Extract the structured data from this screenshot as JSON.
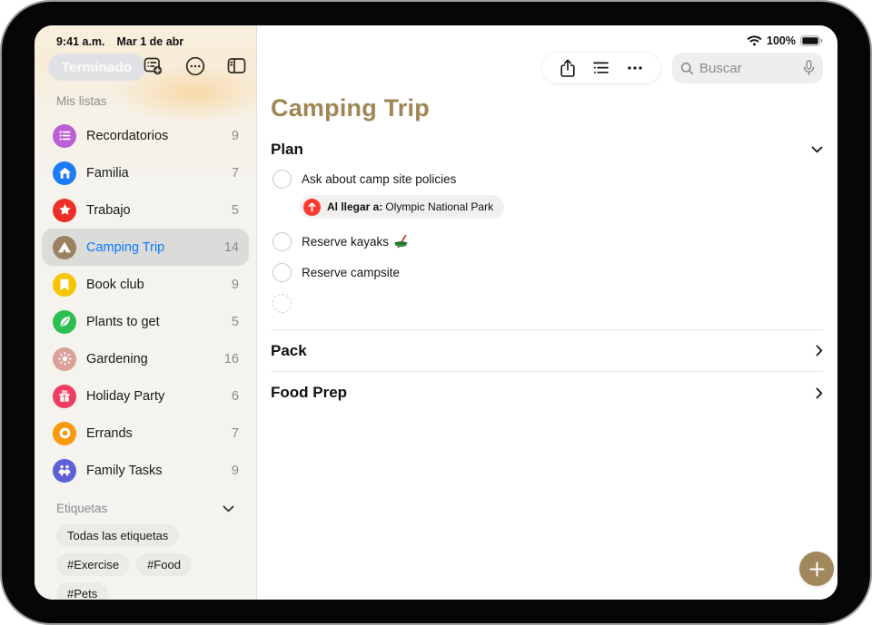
{
  "status_bar": {
    "time": "9:41 a.m.",
    "date": "Mar 1 de abr",
    "battery_percent": "100%"
  },
  "sidebar": {
    "done_button": "Terminado",
    "lists_header": "Mis listas",
    "lists": [
      {
        "name": "Recordatorios",
        "count": "9",
        "color": "#bc60d6",
        "icon": "list-bullets-icon",
        "selected": false
      },
      {
        "name": "Familia",
        "count": "7",
        "color": "#1d7bf6",
        "icon": "house-icon",
        "selected": false
      },
      {
        "name": "Trabajo",
        "count": "5",
        "color": "#eb2f26",
        "icon": "star-icon",
        "selected": false
      },
      {
        "name": "Camping Trip",
        "count": "14",
        "color": "#9a8160",
        "icon": "tent-icon",
        "selected": true
      },
      {
        "name": "Book club",
        "count": "9",
        "color": "#f6c502",
        "icon": "bookmark-icon",
        "selected": false
      },
      {
        "name": "Plants to get",
        "count": "5",
        "color": "#2bbf52",
        "icon": "leaf-icon",
        "selected": false
      },
      {
        "name": "Gardening",
        "count": "16",
        "color": "#d9a19a",
        "icon": "sun-icon",
        "selected": false
      },
      {
        "name": "Holiday Party",
        "count": "6",
        "color": "#ef3d64",
        "icon": "gift-icon",
        "selected": false
      },
      {
        "name": "Errands",
        "count": "7",
        "color": "#f79a0e",
        "icon": "ring-icon",
        "selected": false
      },
      {
        "name": "Family Tasks",
        "count": "9",
        "color": "#5e60d6",
        "icon": "family-icon",
        "selected": false
      }
    ],
    "tags_header": "Etiquetas",
    "tags": [
      "Todas las etiquetas",
      "#Exercise",
      "#Food",
      "#Pets"
    ]
  },
  "toolbar": {
    "search_placeholder": "Buscar"
  },
  "main": {
    "title": "Camping Trip",
    "accent_color": "#a18655",
    "plan_section": {
      "name": "Plan",
      "tasks": [
        {
          "title": "Ask about camp site policies",
          "location_tag": {
            "bold": "Al llegar a:",
            "text": "Olympic National Park"
          }
        },
        {
          "title": "Reserve kayaks",
          "emoji": "canoe-icon"
        },
        {
          "title": "Reserve campsite"
        },
        {
          "title": "",
          "placeholder": true
        }
      ]
    },
    "collapsed_sections": [
      {
        "name": "Pack"
      },
      {
        "name": "Food Prep"
      }
    ]
  }
}
